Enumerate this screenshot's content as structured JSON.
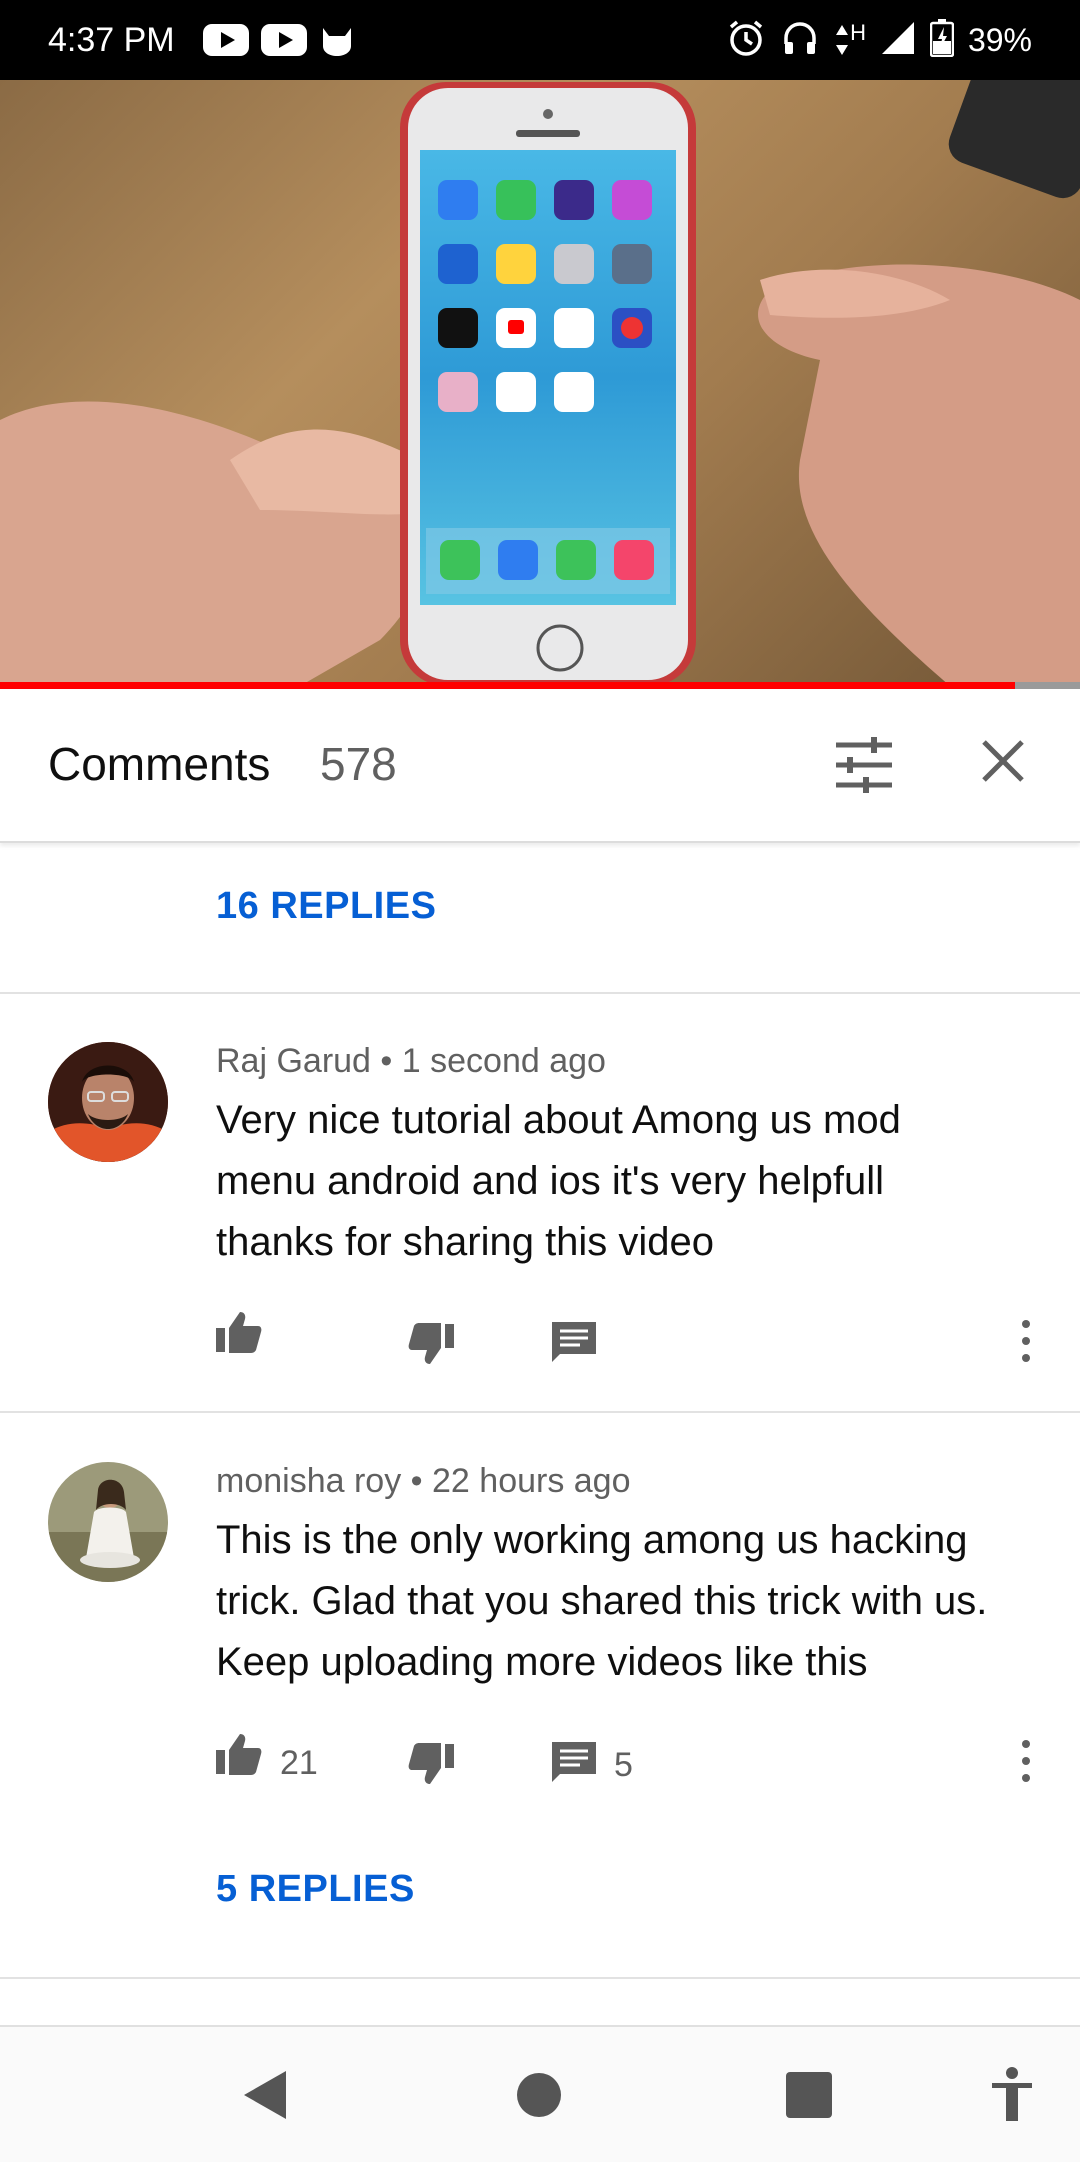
{
  "status_bar": {
    "time": "4:37 PM",
    "network": "H",
    "battery": "39%"
  },
  "video": {
    "progress": 0.94
  },
  "comments_header": {
    "title": "Comments",
    "count": "578"
  },
  "top_replies": "16 REPLIES",
  "comments": [
    {
      "author": "Raj Garud",
      "time": "1 second ago",
      "text_lines": [
        "Very nice tutorial about Among us mod",
        "menu android and ios it's very helpfull",
        "thanks for sharing this video"
      ],
      "likes": "",
      "replies": ""
    },
    {
      "author": "monisha roy",
      "time": "22 hours ago",
      "text_lines": [
        "This is the only working among us hacking",
        "trick. Glad that you shared this trick with us.",
        "Keep uploading more videos like this"
      ],
      "likes": "21",
      "replies": "5",
      "replies_link": "5 REPLIES"
    }
  ],
  "colors": {
    "link": "#065fd4",
    "progress": "#ff0000",
    "icon": "#606060"
  }
}
